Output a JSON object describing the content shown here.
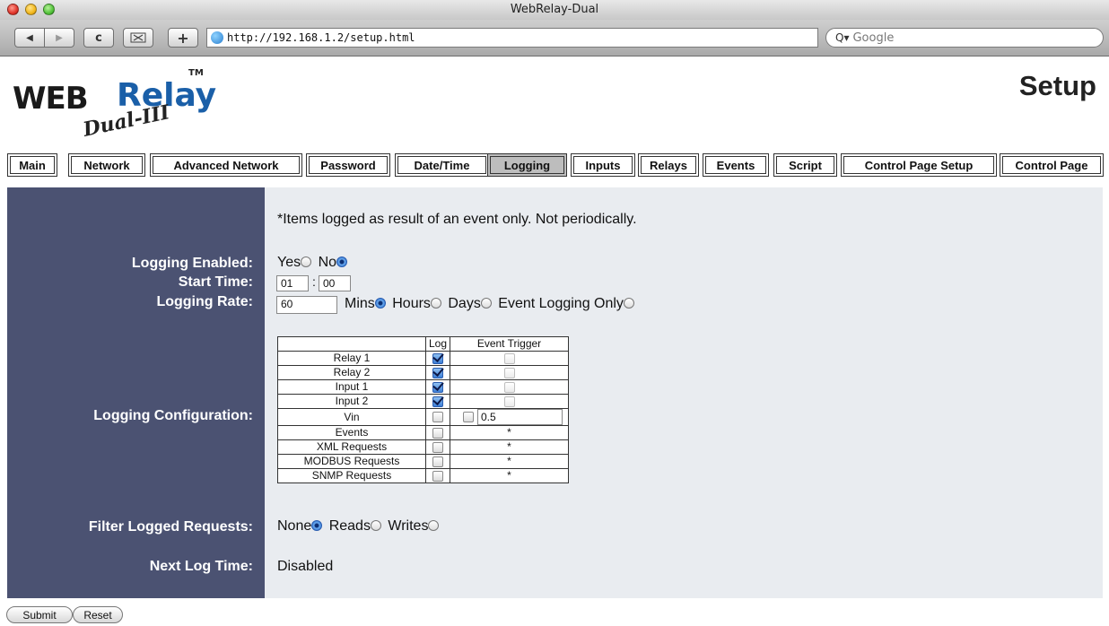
{
  "window": {
    "title": "WebRelay-Dual"
  },
  "browser": {
    "url": "http://192.168.1.2/setup.html",
    "search_placeholder": "Google",
    "back_label": "◀",
    "forward_label": "▶",
    "reload_label": "c",
    "addbook_label": "+"
  },
  "logo": {
    "main": "WEB",
    "relay": "Relay",
    "tm": "TM",
    "model": "Dual-III"
  },
  "page": {
    "title": "Setup"
  },
  "tabs": [
    {
      "label": "Main"
    },
    {
      "label": "Network"
    },
    {
      "label": "Advanced Network"
    },
    {
      "label": "Password"
    },
    {
      "label": "Date/Time"
    },
    {
      "label": "Logging"
    },
    {
      "label": "Inputs"
    },
    {
      "label": "Relays"
    },
    {
      "label": "Events"
    },
    {
      "label": "Script"
    },
    {
      "label": "Control Page Setup"
    },
    {
      "label": "Control Page"
    }
  ],
  "active_tab": "Logging",
  "note": "*Items logged as result of an event only. Not periodically.",
  "logging_enabled": {
    "label": "Logging Enabled:",
    "yes": "Yes",
    "no": "No",
    "selected": "No"
  },
  "start_time": {
    "label": "Start Time:",
    "hour": "01",
    "sep": ":",
    "minute": "00"
  },
  "logging_rate": {
    "label": "Logging Rate:",
    "value": "60",
    "mins": "Mins",
    "hours": "Hours",
    "days": "Days",
    "event_only": "Event Logging Only",
    "selected": "Mins"
  },
  "config": {
    "label": "Logging Configuration:",
    "col_log": "Log",
    "col_event": "Event Trigger",
    "rows": [
      {
        "name": "Relay 1",
        "log": true,
        "event": "checkbox",
        "event_checked": false
      },
      {
        "name": "Relay 2",
        "log": true,
        "event": "checkbox",
        "event_checked": false
      },
      {
        "name": "Input 1",
        "log": true,
        "event": "checkbox",
        "event_checked": false
      },
      {
        "name": "Input 2",
        "log": true,
        "event": "checkbox",
        "event_checked": false
      },
      {
        "name": "Vin",
        "log": false,
        "event": "checkbox+value",
        "event_checked": false,
        "event_value": "0.5"
      },
      {
        "name": "Events",
        "log": false,
        "event": "*"
      },
      {
        "name": "XML Requests",
        "log": false,
        "event": "*"
      },
      {
        "name": "MODBUS Requests",
        "log": false,
        "event": "*"
      },
      {
        "name": "SNMP Requests",
        "log": false,
        "event": "*"
      }
    ]
  },
  "filter": {
    "label": "Filter Logged Requests:",
    "none": "None",
    "reads": "Reads",
    "writes": "Writes",
    "selected": "None"
  },
  "next_log": {
    "label": "Next Log Time:",
    "value": "Disabled"
  },
  "buttons": {
    "submit": "Submit",
    "reset": "Reset"
  }
}
